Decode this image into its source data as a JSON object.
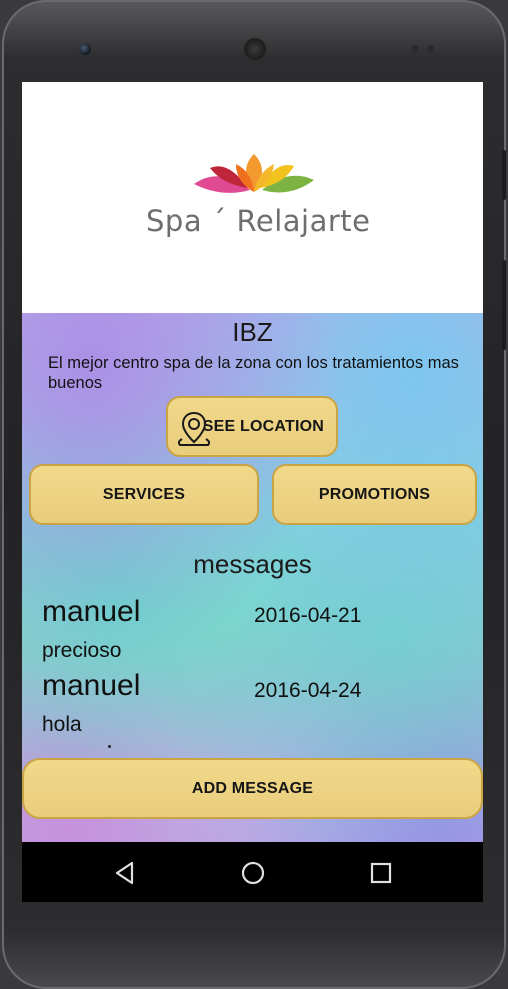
{
  "app": {
    "logo_text": "Spa ´ Relajarte"
  },
  "place": {
    "name": "IBZ",
    "description": "El mejor centro spa de la zona con los tratamientos mas buenos"
  },
  "buttons": {
    "see_location": "SEE LOCATION",
    "services": "SERVICES",
    "promotions": "PROMOTIONS",
    "add_message": "ADD MESSAGE"
  },
  "messages": {
    "heading": "messages",
    "items": [
      {
        "author": "manuel",
        "date": "2016-04-21",
        "text": "precioso"
      },
      {
        "author": "manuel",
        "date": "2016-04-24",
        "text": "hola"
      }
    ]
  },
  "navbar": {
    "back_icon": "back-triangle-icon",
    "home_icon": "home-circle-icon",
    "recents_icon": "recents-square-icon"
  },
  "colors": {
    "button_fill": "#f1d98a",
    "button_border": "#c9a445",
    "navbar": "#000000",
    "lotus_pink": "#e04a93",
    "lotus_orange": "#f29a2e",
    "lotus_yellow": "#f2c31f",
    "lotus_red": "#c0263a",
    "lotus_green": "#7cb342"
  }
}
